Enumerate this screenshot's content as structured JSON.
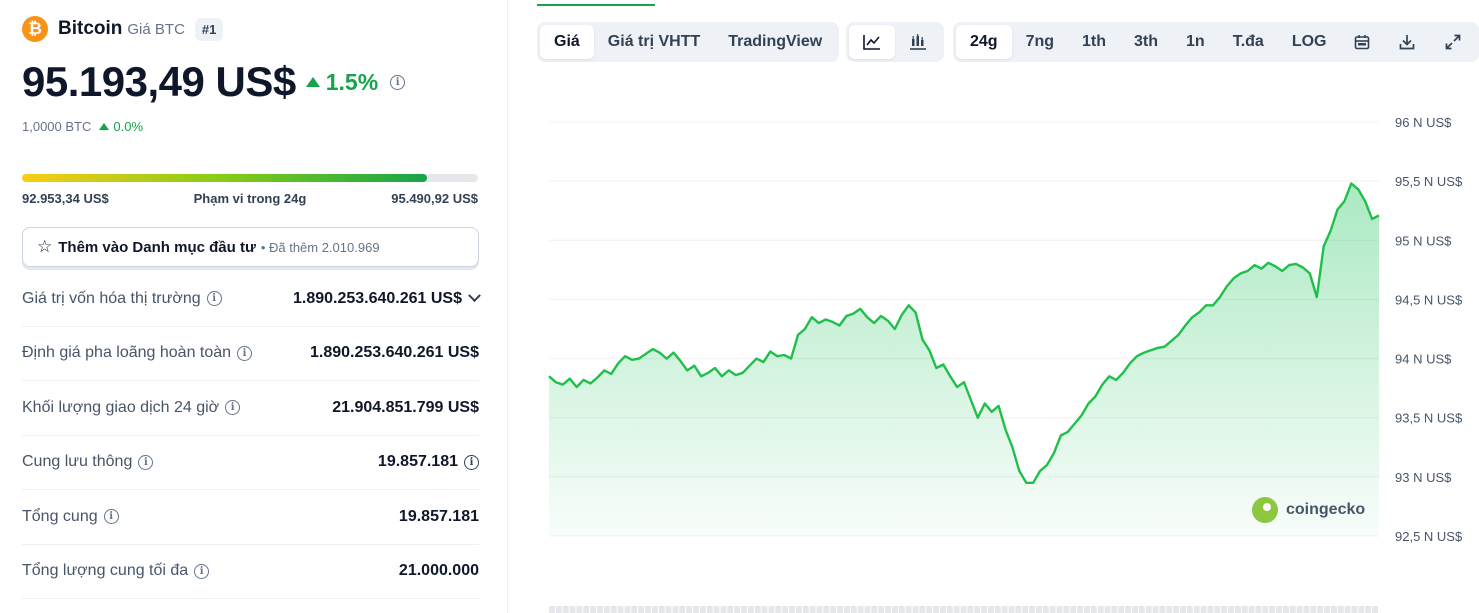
{
  "coin": {
    "logo_glyph": "₿",
    "name": "Bitcoin",
    "symbol_label": "Giá BTC",
    "rank": "#1",
    "price": "95.193,49 US$",
    "change_pct": "1.5%",
    "btc_amount": "1,0000 BTC",
    "btc_change": "0.0%"
  },
  "range": {
    "low": "92.953,34 US$",
    "label": "Phạm vi trong 24g",
    "high": "95.490,92 US$",
    "position_fraction": 0.888
  },
  "watchlist": {
    "label": "Thêm vào Danh mục đầu tư",
    "added": "• Đã thêm 2.010.969",
    "icon": "star-icon"
  },
  "stats": [
    {
      "label": "Giá trị vốn hóa thị trường",
      "value": "1.890.253.640.261 US$",
      "value_info": false,
      "expand": true
    },
    {
      "label": "Định giá pha loãng hoàn toàn",
      "value": "1.890.253.640.261 US$",
      "value_info": false,
      "expand": false
    },
    {
      "label": "Khối lượng giao dịch 24 giờ",
      "value": "21.904.851.799 US$",
      "value_info": false,
      "expand": false
    },
    {
      "label": "Cung lưu thông",
      "value": "19.857.181",
      "value_info": true,
      "expand": false
    },
    {
      "label": "Tổng cung",
      "value": "19.857.181",
      "value_info": false,
      "expand": false
    },
    {
      "label": "Tổng lượng cung tối đa",
      "value": "21.000.000",
      "value_info": false,
      "expand": false
    }
  ],
  "chart_tabs": {
    "view": [
      "Giá",
      "Giá trị VHTT",
      "TradingView"
    ],
    "view_active": 0,
    "chart_type_icons": [
      "line-chart-icon",
      "candlestick-icon"
    ],
    "periods": [
      "24g",
      "7ng",
      "1th",
      "3th",
      "1n",
      "T.đa",
      "LOG"
    ],
    "period_active": 0,
    "tool_icons": [
      "calendar-icon",
      "download-icon",
      "fullscreen-icon"
    ]
  },
  "watermark": "coingecko",
  "colors": {
    "accent_green": "#16a34a",
    "line": "#1fbf4b",
    "btc_orange": "#f7931a"
  },
  "chart_data": {
    "type": "area",
    "y_ticks": [
      "96 N US$",
      "95,5 N US$",
      "95 N US$",
      "94,5 N US$",
      "94 N US$",
      "93,5 N US$",
      "93 N US$",
      "92,5 N US$"
    ],
    "y_tick_values": [
      96000,
      95500,
      95000,
      94500,
      94000,
      93500,
      93000,
      92500
    ],
    "ylim": [
      92500,
      96000
    ],
    "grid": true,
    "values": [
      93850,
      93800,
      93780,
      93830,
      93760,
      93820,
      93790,
      93840,
      93900,
      93870,
      93960,
      94020,
      93990,
      94000,
      94040,
      94080,
      94050,
      94000,
      94050,
      93980,
      93900,
      93940,
      93850,
      93880,
      93920,
      93850,
      93900,
      93860,
      93880,
      93940,
      94000,
      93970,
      94060,
      94020,
      94030,
      94000,
      94200,
      94250,
      94350,
      94300,
      94330,
      94310,
      94280,
      94360,
      94380,
      94420,
      94350,
      94300,
      94360,
      94320,
      94250,
      94370,
      94450,
      94390,
      94160,
      94070,
      93920,
      93950,
      93850,
      93760,
      93800,
      93650,
      93500,
      93620,
      93550,
      93600,
      93400,
      93250,
      93050,
      92950,
      92950,
      93050,
      93100,
      93200,
      93350,
      93380,
      93450,
      93520,
      93620,
      93680,
      93780,
      93850,
      93820,
      93880,
      93960,
      94020,
      94050,
      94070,
      94090,
      94100,
      94150,
      94200,
      94280,
      94350,
      94390,
      94450,
      94450,
      94520,
      94610,
      94680,
      94720,
      94740,
      94790,
      94760,
      94810,
      94780,
      94740,
      94790,
      94800,
      94770,
      94720,
      94520,
      94950,
      95080,
      95260,
      95330,
      95480,
      95430,
      95330,
      95180,
      95210
    ]
  }
}
